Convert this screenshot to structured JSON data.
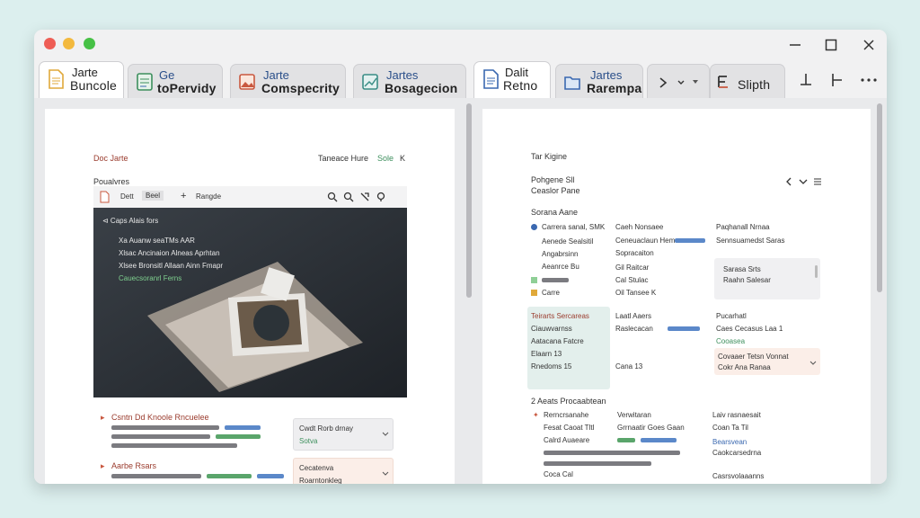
{
  "window": {
    "traffic_lights": {
      "close": "#ee5d55",
      "minimize": "#f3b93e",
      "zoom": "#47c146"
    }
  },
  "tabs": [
    {
      "line1": "Jarte",
      "line2": "Buncole",
      "icon": "document-icon",
      "active": true
    },
    {
      "line1": "Ge",
      "line2": "toPervidy",
      "icon": "spreadsheet-icon",
      "active": false
    },
    {
      "line1": "Jarte",
      "line2": "Comspecrity",
      "icon": "image-icon",
      "active": false
    },
    {
      "line1": "Jartes",
      "line2": "Bosagecion",
      "icon": "chart-icon",
      "active": false
    },
    {
      "line1": "Dalit",
      "line2": "Retno",
      "icon": "document-icon",
      "active": true
    },
    {
      "line1": "Jartes",
      "line2": "Rarempa",
      "icon": "folder-icon",
      "active": false
    },
    {
      "line1": "",
      "line2": "Slipth",
      "icon": "split-icon",
      "active": false
    }
  ],
  "left_pane": {
    "header_left": "Doc Jarte",
    "header_right": "Taneace Hure",
    "header_link": "Sole",
    "header_close": "K",
    "section_label": "Poualvres",
    "viewer_toolbar": {
      "btn1": "Dett",
      "btn2": "Beel",
      "plus": "+",
      "label": "Rangde"
    },
    "overlay_lines": [
      "⊲ Caps Alais fors",
      "Xa Auanw seaTMs AAR",
      "Xlsac Ancinaion Alneas Aprhtan",
      "Xlsee Bronsitl Allaan Ainn Fmapr",
      "Cauecsoranrl Ferns"
    ],
    "item1_title": "Csntn Dd Knoole Rncuelee",
    "item2_title": "Aarbe Rsars",
    "card1_title": "Cwdt Rorb drnay",
    "card1_sub": "Sotva",
    "card2_title": "Cecatenva",
    "card2_sub": "Roarntonkleg"
  },
  "right_pane": {
    "header": "Tar Kigine",
    "sub1": "Pohgene Sll",
    "sub2": "Ceaslor Pane",
    "section1": "Sorana Aane",
    "col1": [
      "Carrera sanal, SMK",
      "Aenede Sealsitil",
      "Angabrsinn",
      "Aeanrce Bu",
      "Carre"
    ],
    "col2": [
      "Caeh Nonsaee",
      "Ceneuaclaun Heme",
      "Sopracaiton",
      "Gil Raitcar",
      "Cal Stulac",
      "Oil Tansee K"
    ],
    "col3": [
      "Paqhanall Nrnaa",
      "Sennsuamedst Saras"
    ],
    "box_lines": [
      "Sarasa Srts",
      "Raahn Salesar"
    ],
    "section2": "Teirarts Sercareas",
    "row2_col1": [
      "Ciauwvarnss",
      "Aatacana Fatcre",
      "Elaarn 13",
      "Rnedoms 15"
    ],
    "row2_col2": [
      "Laatl Aaers",
      "Raslecacan",
      "Cana 13"
    ],
    "row2_col3": [
      "Pucarhatl",
      "Caes Cecasus Laa 1",
      "Cooasea",
      "Covaaer Tetsn Vonnat",
      "Cokr Ana Ranaa"
    ],
    "section3": "2 Aeats Procaabtean",
    "row3_col1": [
      "Rerncrsanahe",
      "Fesat Caoat Tltl",
      "Calrd Auaeare",
      "Coca Cal"
    ],
    "row3_col2": [
      "Verwitaran",
      "Grrnaatir Goes Gaan"
    ],
    "row3_col3": [
      "Laiv rasnaesait",
      "Coan Ta Til",
      "Bearsvean",
      "Caokcarsedrna",
      "Casrsvolaaanns"
    ]
  }
}
